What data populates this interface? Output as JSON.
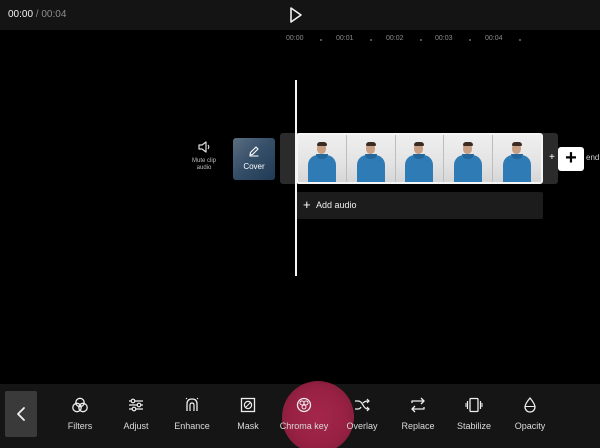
{
  "header": {
    "current_time": "00:00",
    "separator": " / ",
    "total_time": "00:04"
  },
  "ruler": {
    "ticks": [
      "00:00",
      "00:01",
      "00:02",
      "00:03",
      "00:04"
    ]
  },
  "track": {
    "mute_label_line1": "Mute clip",
    "mute_label_line2": "audio",
    "cover_label": "Cover",
    "end_text": "end",
    "add_audio_label": "Add audio"
  },
  "toolbar": {
    "tools": [
      {
        "label": "Filters",
        "icon": "filters-icon"
      },
      {
        "label": "Adjust",
        "icon": "adjust-icon"
      },
      {
        "label": "Enhance",
        "icon": "enhance-icon"
      },
      {
        "label": "Mask",
        "icon": "mask-icon"
      },
      {
        "label": "Chroma key",
        "icon": "chroma-key-icon"
      },
      {
        "label": "Overlay",
        "icon": "overlay-icon"
      },
      {
        "label": "Replace",
        "icon": "replace-icon"
      },
      {
        "label": "Stabilize",
        "icon": "stabilize-icon"
      },
      {
        "label": "Opacity",
        "icon": "opacity-icon"
      }
    ]
  },
  "colors": {
    "background": "#000000",
    "toolbar": "#151515",
    "highlight": "#a32247",
    "playhead": "#f4f4f4"
  }
}
